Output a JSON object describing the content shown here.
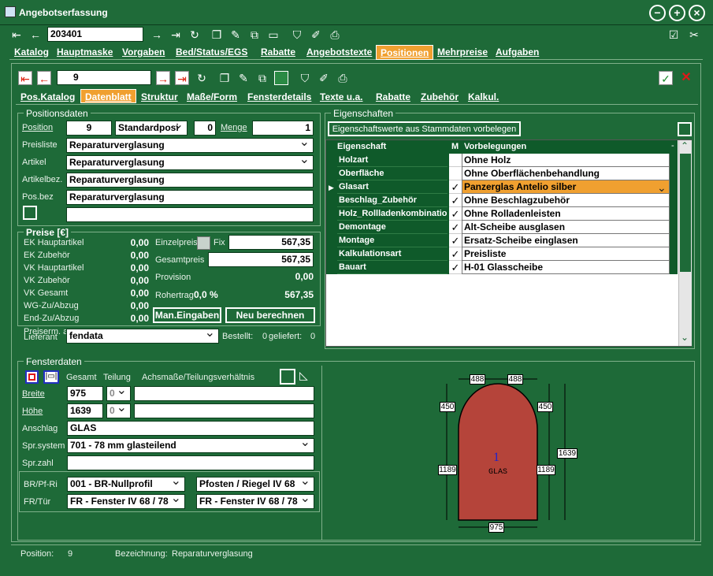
{
  "window": {
    "title": "Angebotserfassung"
  },
  "toolbar": {
    "record_number": "203401"
  },
  "main_tabs": [
    "Katalog",
    "Hauptmaske",
    "Vorgaben",
    "Bed/Status/EGS",
    "Rabatte",
    "Angebotstexte",
    "Positionen",
    "Mehrpreise",
    "Aufgaben"
  ],
  "active_main_tab": "Positionen",
  "pos_toolbar": {
    "position_number": "9"
  },
  "sub_tabs": [
    "Pos.Katalog",
    "Datenblatt",
    "Struktur",
    "Maße/Form",
    "Fensterdetails",
    "Texte u.a.",
    "Rabatte",
    "Zubehör",
    "Kalkul."
  ],
  "active_sub_tab": "Datenblatt",
  "positionsdaten": {
    "title": "Positionsdaten",
    "position_label": "Position",
    "position_value": "9",
    "position_type": "Standardposi",
    "zero_value": "0",
    "menge_label": "Menge",
    "menge_value": "1",
    "preisliste_label": "Preisliste",
    "preisliste_value": "Reparaturverglasung",
    "artikel_label": "Artikel",
    "artikel_value": "Reparaturverglasung",
    "artikelbez_label": "Artikelbez.",
    "artikelbez_value": "Reparaturverglasung",
    "posbez_label": "Pos.bez",
    "posbez_value": "Reparaturverglasung"
  },
  "preise": {
    "title": "Preise [€]",
    "rows": [
      {
        "label": "EK Hauptartikel",
        "value": "0,00"
      },
      {
        "label": "EK Zubehör",
        "value": "0,00"
      },
      {
        "label": "VK Hauptartikel",
        "value": "0,00"
      },
      {
        "label": "VK Zubehör",
        "value": "0,00"
      },
      {
        "label": "VK Gesamt",
        "value": "0,00"
      },
      {
        "label": "WG-Zu/Abzug",
        "value": "0,00"
      },
      {
        "label": "End-Zu/Abzug",
        "value": "0,00"
      }
    ],
    "einzelpreis_label": "Einzelpreis",
    "fix_label": "Fix",
    "einzelpreis_value": "567,35",
    "gesamtpreis_label": "Gesamtpreis",
    "gesamtpreis_value": "567,35",
    "provision_label": "Provision",
    "provision_value": "0,00",
    "rohertrag_label": "Rohertrag",
    "rohertrag_pct": "0,0 %",
    "rohertrag_value": "567,35",
    "man_eingaben": "Man.Eingaben",
    "neu_berechnen": "Neu berechnen",
    "lieferant_label": "Lieferant",
    "lieferant_overlap": "Preiserm. a",
    "lieferant_value": "fendata",
    "bestellt_label": "Bestellt:",
    "bestellt_value": "0",
    "geliefert_label": "geliefert:",
    "geliefert_value": "0"
  },
  "eigenschaften": {
    "title": "Eigenschaften",
    "vorbelegen_button": "Eigenschaftswerte aus Stammdaten vorbelegen",
    "col_eigenschaft": "Eigenschaft",
    "col_m": "M",
    "col_vorbelegungen": "Vorbelegungen",
    "rows": [
      {
        "name": "Holzart",
        "m": "",
        "value": "Ohne Holz"
      },
      {
        "name": "Oberfläche",
        "m": "",
        "value": "Ohne Oberflächenbehandlung"
      },
      {
        "name": "Glasart",
        "m": "✓",
        "value": "Panzerglas Antelio silber",
        "selected": true
      },
      {
        "name": "Beschlag_Zubehör",
        "m": "✓",
        "value": "Ohne Beschlagzubehör"
      },
      {
        "name": "Holz_Rollladenkombination",
        "m": "✓",
        "value": "Ohne Rolladenleisten"
      },
      {
        "name": "Demontage",
        "m": "✓",
        "value": "Alt-Scheibe ausglasen"
      },
      {
        "name": "Montage",
        "m": "✓",
        "value": "Ersatz-Scheibe einglasen"
      },
      {
        "name": "Kalkulationsart",
        "m": "✓",
        "value": "Preisliste"
      },
      {
        "name": "Bauart",
        "m": "✓",
        "value": "H-01 Glasscheibe"
      }
    ]
  },
  "fensterdaten": {
    "title": "Fensterdaten",
    "gesamt_label": "Gesamt",
    "teilung_label": "Teilung",
    "achsmasse_label": "Achsmaße/Teilungsverhältnis",
    "breite_label": "Breite",
    "breite_value": "975",
    "breite_teilung": "0",
    "hoehe_label": "Höhe",
    "hoehe_value": "1639",
    "hoehe_teilung": "0",
    "anschlag_label": "Anschlag",
    "anschlag_value": "GLAS",
    "sprsystem_label": "Spr.system",
    "sprsystem_value": "701 - 78 mm glasteilend",
    "sprzahl_label": "Spr.zahl",
    "brptri_label": "BR/Pf-Ri",
    "brptri_value": "001 - BR-Nullprofil",
    "pfosten_value": "Pfosten / Riegel IV 68",
    "frtuer_label": "FR/Tür",
    "frtuer_value": "FR - Fenster IV 68 / 78",
    "frtuer_value2": "FR - Fenster IV 68 / 78"
  },
  "drawing": {
    "top_left": "488",
    "top_right": "488",
    "left_arc": "450",
    "right_arc": "450",
    "left_height": "1189",
    "right_height": "1189",
    "total_height": "1639",
    "width": "975",
    "pane_number": "1",
    "pane_label": "GLAS",
    "fill_color": "#b5443a"
  },
  "statusbar": {
    "position_label": "Position:",
    "position_value": "9",
    "bezeichnung_label": "Bezeichnung:",
    "bezeichnung_value": "Reparaturverglasung"
  }
}
